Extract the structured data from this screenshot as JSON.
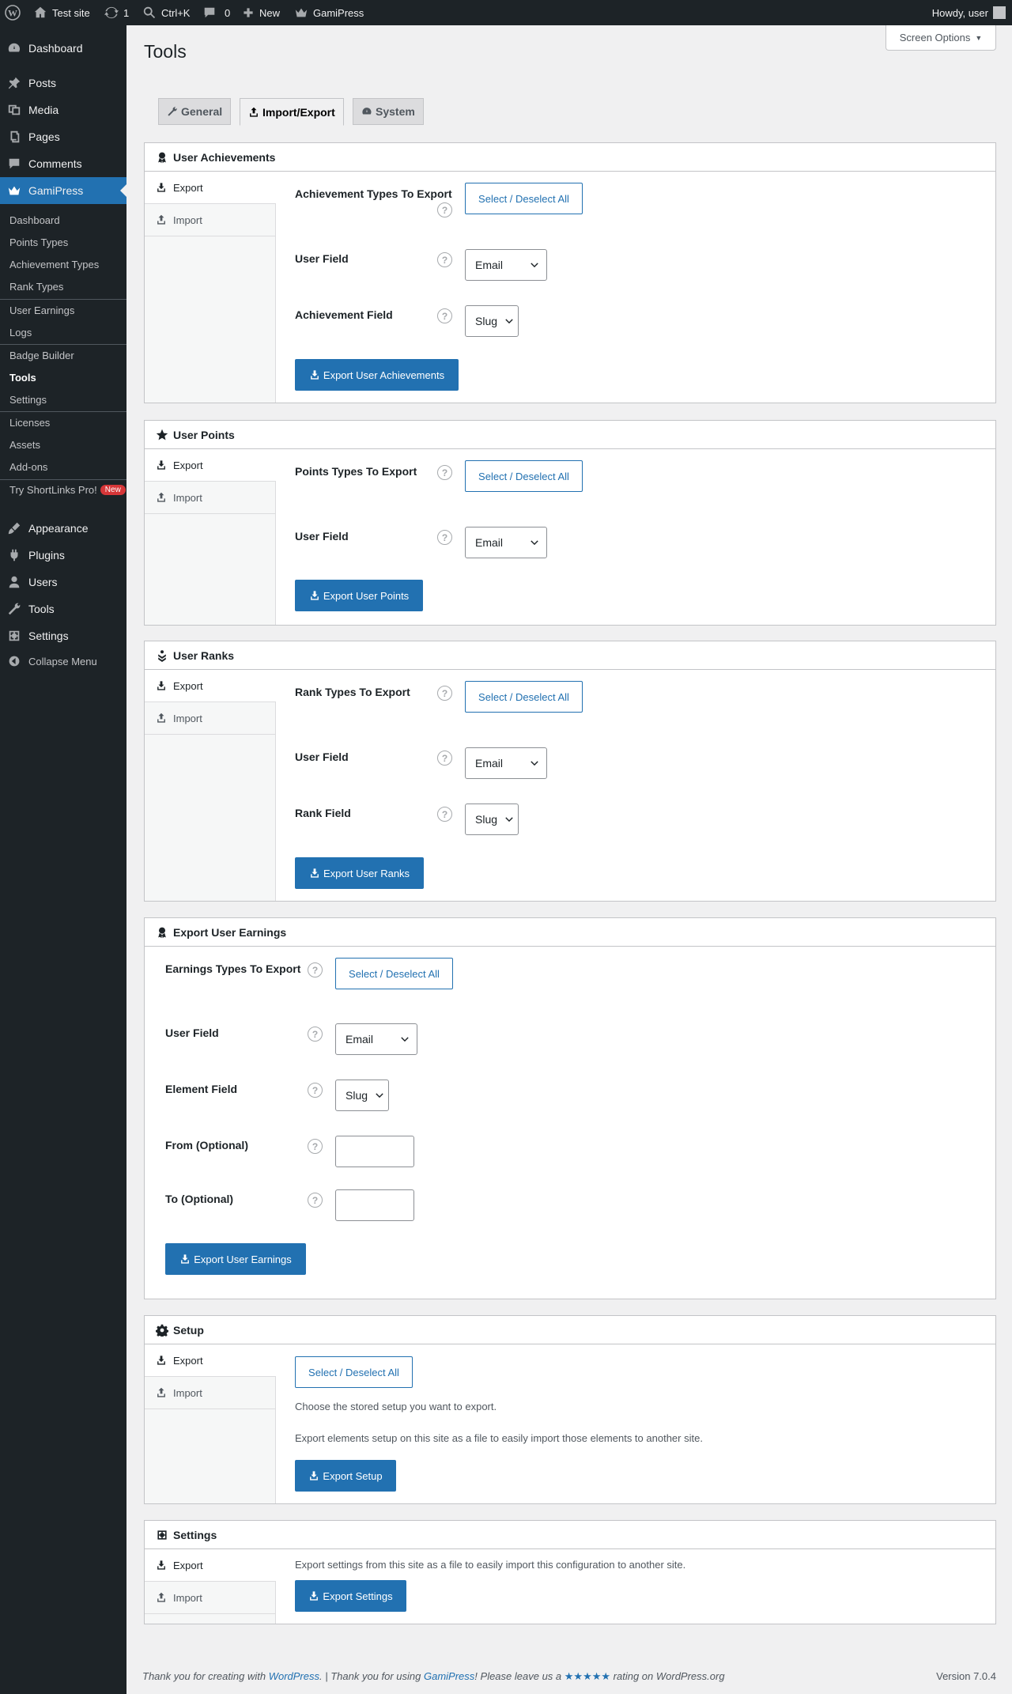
{
  "adminbar": {
    "site": "Test site",
    "updates": "1",
    "search": "Ctrl+K",
    "comments": "0",
    "new": "New",
    "gamipress": "GamiPress",
    "howdy": "Howdy, user"
  },
  "menu": {
    "dashboard": "Dashboard",
    "posts": "Posts",
    "media": "Media",
    "pages": "Pages",
    "comments": "Comments",
    "gamipress": "GamiPress",
    "appearance": "Appearance",
    "plugins": "Plugins",
    "users": "Users",
    "tools": "Tools",
    "settings": "Settings",
    "collapse": "Collapse Menu"
  },
  "submenu": {
    "dashboard": "Dashboard",
    "points_types": "Points Types",
    "achievement_types": "Achievement Types",
    "rank_types": "Rank Types",
    "user_earnings": "User Earnings",
    "logs": "Logs",
    "badge_builder": "Badge Builder",
    "tools": "Tools",
    "settings": "Settings",
    "licenses": "Licenses",
    "assets": "Assets",
    "addons": "Add-ons",
    "shortlinks": "Try ShortLinks Pro!",
    "new_badge": "New"
  },
  "page": {
    "title": "Tools",
    "screen_options": "Screen Options"
  },
  "tabs": {
    "general": "General",
    "import_export": "Import/Export",
    "system": "System"
  },
  "common": {
    "export": "Export",
    "import": "Import",
    "select_all": "Select / Deselect All",
    "email": "Email",
    "slug": "Slug",
    "help": "?",
    "user_field": "User Field"
  },
  "achievements": {
    "title": "User Achievements",
    "types_label": "Achievement Types To Export",
    "field_label": "Achievement Field",
    "button": "Export User Achievements"
  },
  "points": {
    "title": "User Points",
    "types_label": "Points Types To Export",
    "button": "Export User Points"
  },
  "ranks": {
    "title": "User Ranks",
    "types_label": "Rank Types To Export",
    "field_label": "Rank Field",
    "button": "Export User Ranks"
  },
  "earnings": {
    "title": "Export User Earnings",
    "types_label": "Earnings Types To Export",
    "element_label": "Element Field",
    "from_label": "From (Optional)",
    "to_label": "To (Optional)",
    "button": "Export User Earnings"
  },
  "setup": {
    "title": "Setup",
    "desc1": "Choose the stored setup you want to export.",
    "desc2": "Export elements setup on this site as a file to easily import those elements to another site.",
    "button": "Export Setup"
  },
  "settings": {
    "title": "Settings",
    "desc": "Export settings from this site as a file to easily import this configuration to another site.",
    "button": "Export Settings"
  },
  "footer": {
    "t1": "Thank you for creating with ",
    "wp": "WordPress",
    "t2": ". | Thank you for using ",
    "gp": "GamiPress",
    "t3": "! Please leave us a ",
    "stars": "★★★★★",
    "t4": " rating on WordPress.org",
    "version": "Version 7.0.4"
  },
  "colors": {
    "accent": "#2271b1",
    "sidebar": "#1d2327"
  }
}
